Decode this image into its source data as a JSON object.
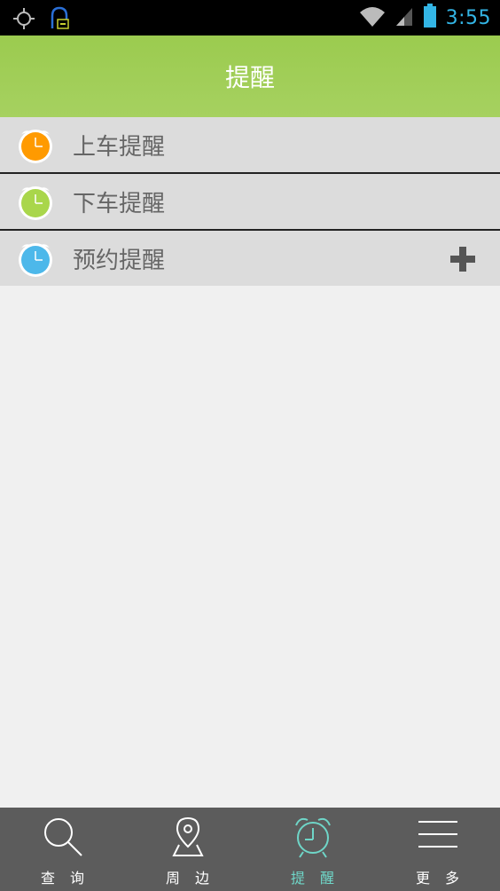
{
  "status_bar": {
    "time": "3:55"
  },
  "header": {
    "title": "提醒"
  },
  "reminders": [
    {
      "label": "上车提醒",
      "icon": "alarm-clock-icon",
      "color": "#ff9a00"
    },
    {
      "label": "下车提醒",
      "icon": "alarm-clock-icon",
      "color": "#a9d64b"
    },
    {
      "label": "预约提醒",
      "icon": "alarm-clock-icon",
      "color": "#4db8ea"
    }
  ],
  "tabs": [
    {
      "label": "查 询",
      "icon": "search-icon",
      "active": false
    },
    {
      "label": "周 边",
      "icon": "map-pin-icon",
      "active": false
    },
    {
      "label": "提 醒",
      "icon": "alarm-clock-icon",
      "active": true
    },
    {
      "label": "更 多",
      "icon": "menu-icon",
      "active": false
    }
  ],
  "colors": {
    "header": "#9bcb4f",
    "active_tab": "#6fd6c8",
    "status_accent": "#33b5e5"
  }
}
